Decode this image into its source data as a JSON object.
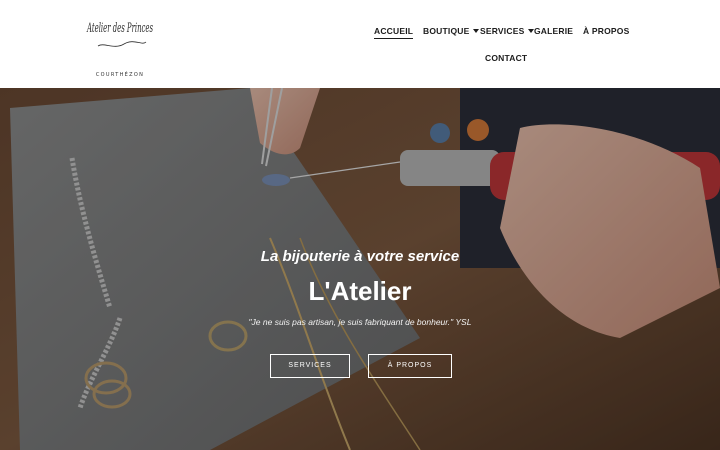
{
  "header": {
    "logo": {
      "script_text": "Atelier des Princes",
      "subtitle": "COURTHÉZON"
    },
    "nav": {
      "items": [
        {
          "label": "ACCUEIL",
          "active": true,
          "has_dropdown": false
        },
        {
          "label": "BOUTIQUE",
          "active": false,
          "has_dropdown": true
        },
        {
          "label": "SERVICES",
          "active": false,
          "has_dropdown": true
        },
        {
          "label": "GALERIE",
          "active": false,
          "has_dropdown": false
        },
        {
          "label": "À PROPOS",
          "active": false,
          "has_dropdown": false
        },
        {
          "label": "CONTACT",
          "active": false,
          "has_dropdown": false
        }
      ]
    }
  },
  "hero": {
    "tagline": "La bijouterie à votre service",
    "title": "L'Atelier",
    "quote": "\"Je ne suis pas artisan, je suis fabriquant de bonheur.\" YSL",
    "buttons": {
      "services": "SERVICES",
      "apropos": "À PROPOS"
    }
  },
  "colors": {
    "header_bg": "#ffffff",
    "nav_text": "#1c1c1c",
    "hero_text": "#ffffff"
  }
}
